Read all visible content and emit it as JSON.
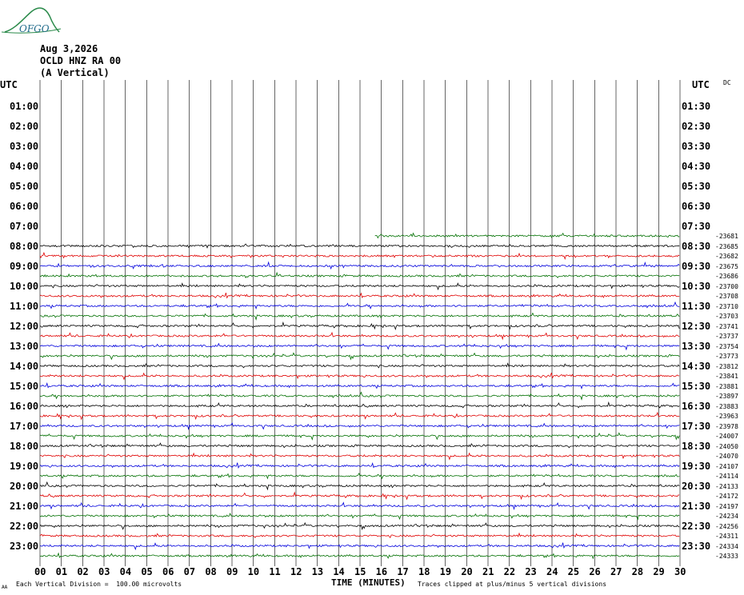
{
  "logo": {
    "text": "OFGO"
  },
  "header": {
    "date": "Aug 3,2026",
    "station": "OCLD HNZ RA 00",
    "component": "(A Vertical)",
    "utc_left": "UTC",
    "utc_right": "UTC",
    "dc": "DC"
  },
  "footer": {
    "division": "Each Vertical Division =  100.00 microvolts",
    "xlabel": "TIME (MINUTES)",
    "clip": "Traces clipped at plus/minus 5 vertical divisions",
    "corner": "AA"
  },
  "colors": {
    "black": "#000000",
    "red": "#e00000",
    "blue": "#0000dd",
    "green": "#007000",
    "logo": "#2a8a4a"
  },
  "chart_data": {
    "type": "line",
    "title": "Aug 3,2026 OCLD HNZ RA 00 (A Vertical)",
    "xlabel": "TIME (MINUTES)",
    "xlim": [
      0,
      30
    ],
    "x_ticks": [
      "00",
      "01",
      "02",
      "03",
      "04",
      "05",
      "06",
      "07",
      "08",
      "09",
      "10",
      "11",
      "12",
      "13",
      "14",
      "15",
      "16",
      "17",
      "18",
      "19",
      "20",
      "21",
      "22",
      "23",
      "24",
      "25",
      "26",
      "27",
      "28",
      "29",
      "30"
    ],
    "left_labels": [
      "01:00",
      "02:00",
      "03:00",
      "04:00",
      "05:00",
      "06:00",
      "07:00",
      "08:00",
      "09:00",
      "10:00",
      "11:00",
      "12:00",
      "13:00",
      "14:00",
      "15:00",
      "16:00",
      "17:00",
      "18:00",
      "19:00",
      "20:00",
      "21:00",
      "22:00",
      "23:00"
    ],
    "right_labels": [
      "01:30",
      "02:30",
      "03:30",
      "04:30",
      "05:30",
      "06:30",
      "07:30",
      "08:30",
      "09:30",
      "10:30",
      "11:30",
      "12:30",
      "13:30",
      "14:30",
      "15:30",
      "16:30",
      "17:30",
      "18:30",
      "19:30",
      "20:30",
      "21:30",
      "22:30",
      "23:30"
    ],
    "trace_start_row": 7,
    "trace_colors": [
      "green",
      "black",
      "red",
      "blue"
    ],
    "first_trace_start_minute": 15.7,
    "dc_values": [
      "-23681",
      "-23685",
      "-23682",
      "-23675",
      "-23686",
      "-23700",
      "-23708",
      "-23710",
      "-23703",
      "-23741",
      "-23737",
      "-23754",
      "-23773",
      "-23812",
      "-23841",
      "-23881",
      "-23897",
      "-23883",
      "-23963",
      "-23978",
      "-24007",
      "-24050",
      "-24070",
      "-24107",
      "-24114",
      "-24133",
      "-24172",
      "-24197",
      "-24234",
      "-24256",
      "-24311",
      "-24334",
      "-24333"
    ],
    "grid": true
  }
}
